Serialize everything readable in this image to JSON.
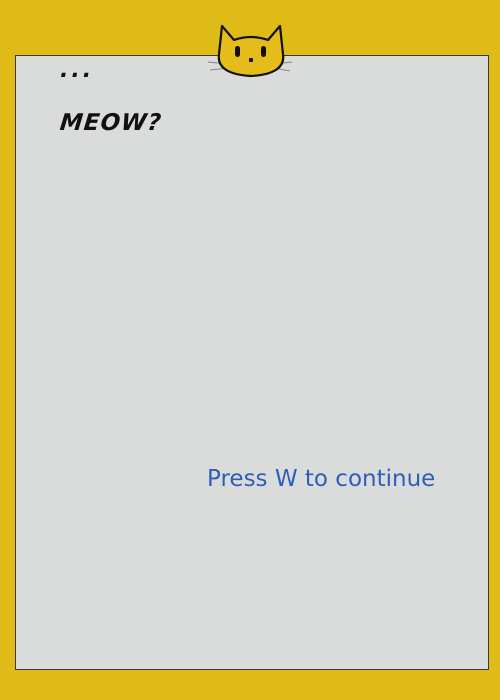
{
  "dialog": {
    "lines": [
      "...",
      "MEOW?"
    ],
    "continue_prompt": "Press W to continue"
  },
  "icons": {
    "header_icon": "cat-face-icon"
  },
  "colors": {
    "background": "#dfbb18",
    "panel": "#dadcdb",
    "panel_border": "#3a3a3a",
    "dialog_text": "#111111",
    "prompt_text": "#2e5fb8",
    "cat_fill": "#e6bc1a"
  }
}
